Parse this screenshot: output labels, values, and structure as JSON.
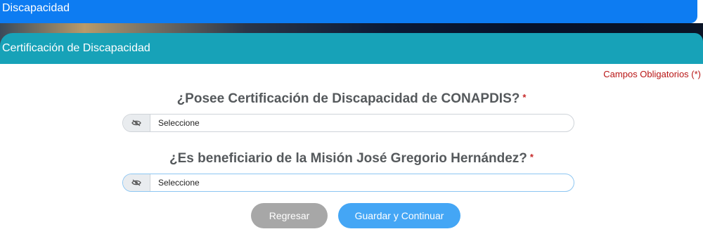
{
  "header": {
    "title": "Discapacidad"
  },
  "section": {
    "title": "Certificación de Discapacidad"
  },
  "form": {
    "required_note": "Campos Obligatorios (*)",
    "required_mark": "*",
    "questions": [
      {
        "label": "¿Posee Certificación de Discapacidad de CONAPDIS?",
        "selected": "Seleccione",
        "icon": "eye-slash-icon"
      },
      {
        "label": "¿Es beneficiario de la Misión José Gregorio Hernández?",
        "selected": "Seleccione",
        "icon": "eye-slash-icon"
      }
    ]
  },
  "buttons": {
    "back": "Regresar",
    "save": "Guardar y Continuar"
  },
  "colors": {
    "top_bar": "#0d7cf2",
    "section_header": "#17a2b8",
    "required": "#b81414",
    "back_button": "#a7a7a7",
    "save_button": "#44a6f5"
  }
}
